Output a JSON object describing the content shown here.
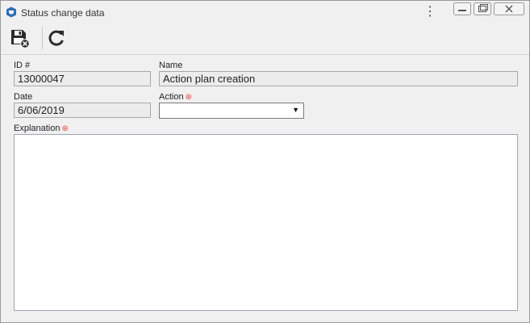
{
  "window": {
    "title": "Status change data"
  },
  "icons": {
    "app": "app-logo-icon",
    "menu": "kebab-menu-icon",
    "minimize": "minimize-icon",
    "restore": "restore-icon",
    "close": "close-icon",
    "save": "save-close-icon",
    "refresh": "refresh-icon"
  },
  "form": {
    "id": {
      "label": "ID #",
      "value": "13000047"
    },
    "name": {
      "label": "Name",
      "value": "Action plan creation"
    },
    "date": {
      "label": "Date",
      "value": "6/06/2019"
    },
    "action": {
      "label": "Action",
      "value": ""
    },
    "explanation": {
      "label": "Explanation",
      "value": ""
    }
  },
  "colors": {
    "required": "#e8403a",
    "window_bg": "#f0f0f0"
  }
}
